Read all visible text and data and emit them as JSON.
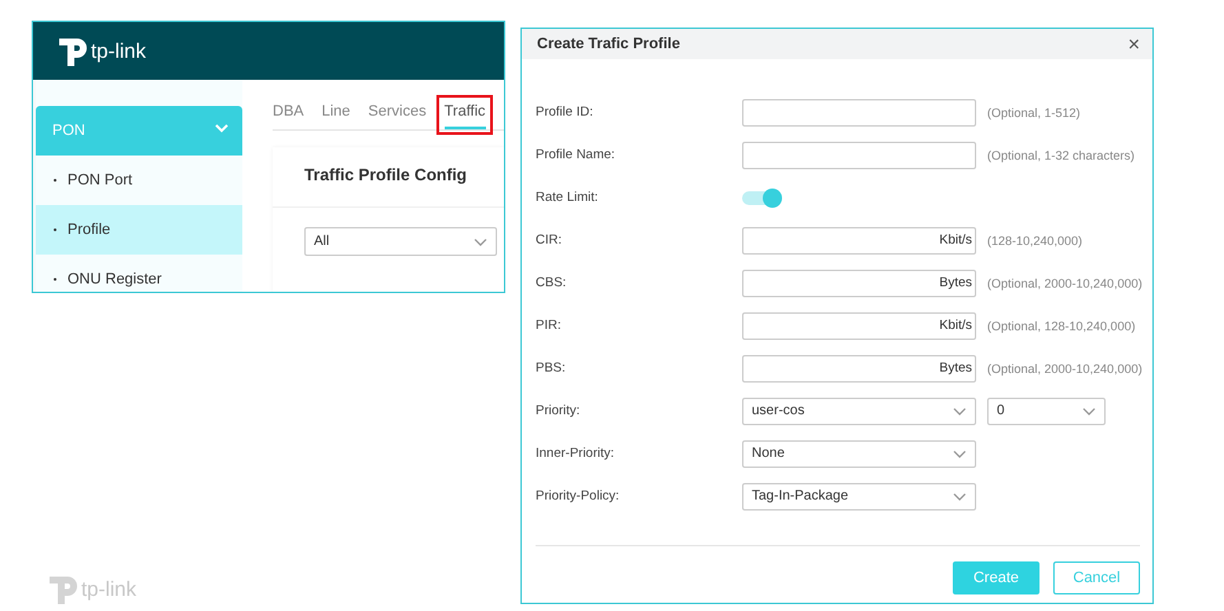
{
  "left_panel": {
    "logo": "tp-link",
    "sidebar": {
      "group": {
        "label": "PON",
        "expanded": true
      },
      "items": [
        {
          "label": "PON Port",
          "selected": false
        },
        {
          "label": "Profile",
          "selected": true
        },
        {
          "label": "ONU Register",
          "selected": false
        }
      ]
    },
    "tabs": [
      {
        "label": "DBA",
        "selected": false,
        "highlighted": false
      },
      {
        "label": "Line",
        "selected": false,
        "highlighted": false
      },
      {
        "label": "Services",
        "selected": false,
        "highlighted": false
      },
      {
        "label": "Traffic",
        "selected": true,
        "highlighted": true
      }
    ],
    "card_title": "Traffic Profile Config",
    "filter": {
      "value": "All"
    }
  },
  "footer_logo": "tp-link",
  "dialog": {
    "title": "Create Trafic Profile",
    "close": "×",
    "rows": [
      {
        "kind": "input",
        "label": "Profile ID:",
        "hint": "(Optional, 1-512)"
      },
      {
        "kind": "input",
        "label": "Profile Name:",
        "hint": "(Optional, 1-32 characters)"
      },
      {
        "kind": "toggle",
        "label": "Rate Limit:",
        "on": true
      },
      {
        "kind": "input",
        "label": "CIR:",
        "unit": "Kbit/s",
        "hint": "(128-10,240,000)"
      },
      {
        "kind": "input",
        "label": "CBS:",
        "unit": "Bytes",
        "hint": "(Optional, 2000-10,240,000)"
      },
      {
        "kind": "input",
        "label": "PIR:",
        "unit": "Kbit/s",
        "hint": "(Optional, 128-10,240,000)"
      },
      {
        "kind": "input",
        "label": "PBS:",
        "unit": "Bytes",
        "hint": "(Optional, 2000-10,240,000)"
      },
      {
        "kind": "select",
        "label": "Priority:",
        "selects": [
          {
            "value": "user-cos"
          },
          {
            "value": "0"
          }
        ]
      },
      {
        "kind": "select",
        "label": "Inner-Priority:",
        "selects": [
          {
            "value": "None"
          }
        ]
      },
      {
        "kind": "select",
        "label": "Priority-Policy:",
        "selects": [
          {
            "value": "Tag-In-Package"
          }
        ]
      }
    ],
    "buttons": [
      {
        "label": "Create",
        "kind": "primary"
      },
      {
        "label": "Cancel",
        "kind": "secondary"
      }
    ]
  }
}
